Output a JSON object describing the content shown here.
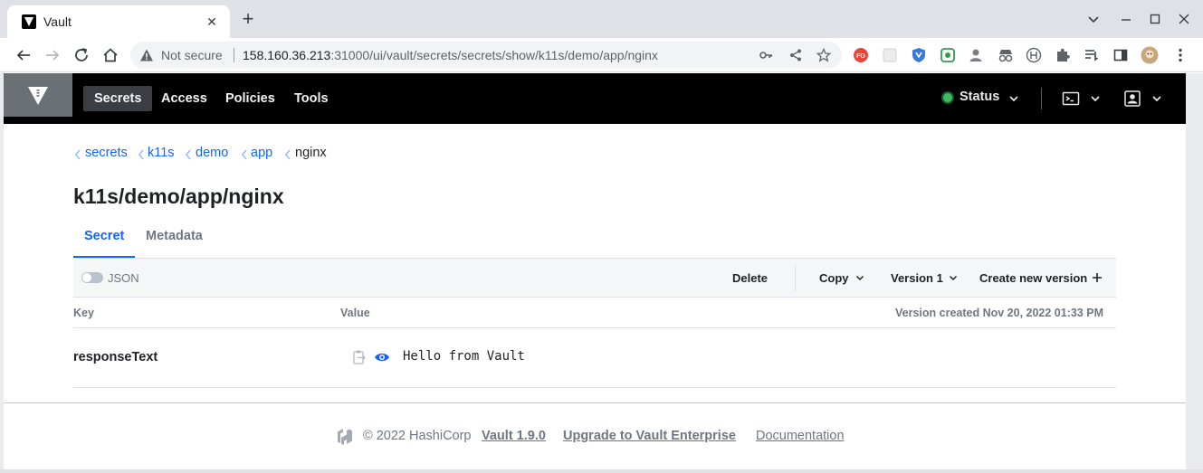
{
  "browser": {
    "tab_title": "Vault",
    "tab_close": "✕",
    "new_tab": "+",
    "security_label": "Not secure",
    "url_host": "158.160.36.213",
    "url_rest": ":31000/ui/vault/secrets/secrets/show/k11s/demo/app/nginx",
    "extension_badge": "FO"
  },
  "nav": {
    "links": [
      "Secrets",
      "Access",
      "Policies",
      "Tools"
    ],
    "status_label": "Status",
    "status_color": "#3fbb5f"
  },
  "breadcrumb": {
    "items": [
      "secrets",
      "k11s",
      "demo",
      "app"
    ],
    "current": "nginx"
  },
  "page": {
    "title": "k11s/demo/app/nginx",
    "tabs": [
      "Secret",
      "Metadata"
    ],
    "active_tab": "Secret"
  },
  "toolbar": {
    "json_label": "JSON",
    "json_enabled": false,
    "delete_label": "Delete",
    "copy_label": "Copy",
    "version_label": "Version 1",
    "create_label": "Create new version"
  },
  "table": {
    "headers": {
      "key": "Key",
      "value": "Value",
      "version_created": "Version created Nov 20, 2022 01:33 PM"
    },
    "rows": [
      {
        "key": "responseText",
        "value": "Hello from Vault"
      }
    ]
  },
  "footer": {
    "copyright": "© 2022 HashiCorp",
    "version_link": "Vault 1.9.0",
    "upgrade_link": "Upgrade to Vault Enterprise",
    "docs_link": "Documentation"
  },
  "colors": {
    "accent": "#1563ff",
    "nav_background": "#000000"
  }
}
